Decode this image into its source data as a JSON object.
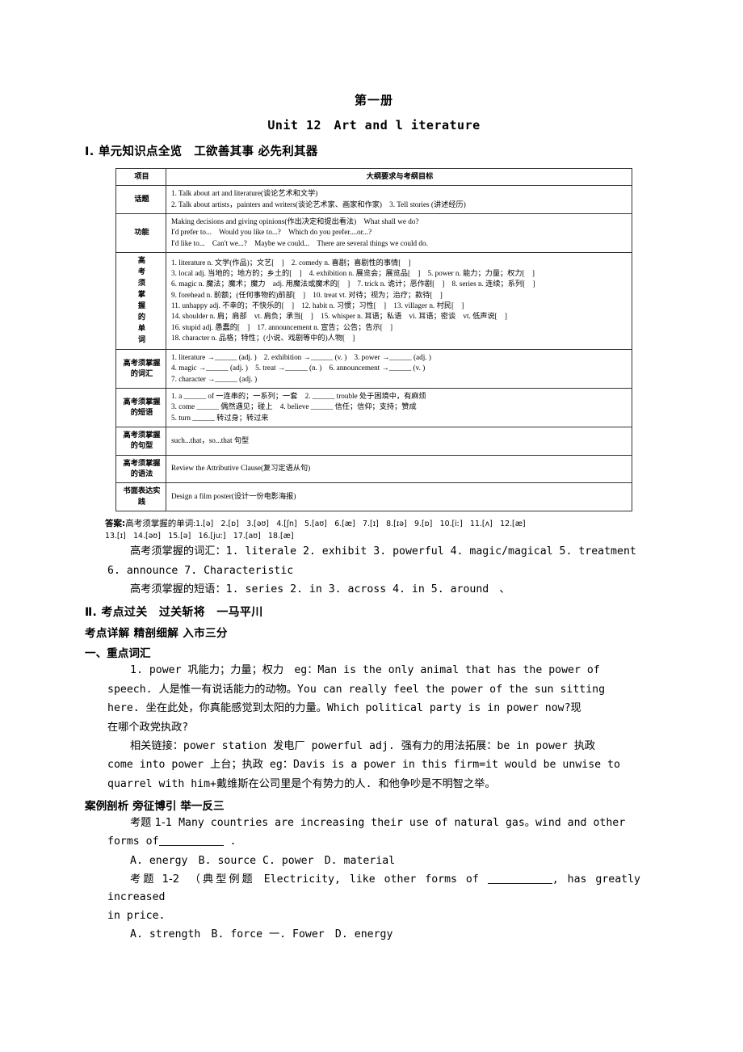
{
  "header": {
    "book": "第一册",
    "unit": "Unit 12　Art and l iterature",
    "section1": "Ⅰ. 单元知识点全览　工欲善其事 必先利其器"
  },
  "table": {
    "col1_header": "项目",
    "col2_header": "大纲要求与考纲目标",
    "rows": [
      {
        "label": "话题",
        "lines": [
          "1. Talk about art and literature(谈论艺术和文学)",
          "2. Talk about artists，painters and writers(谈论艺术家、画家和作家)　3. Tell stories (讲述经历)"
        ]
      },
      {
        "label": "功能",
        "lines": [
          "Making decisions and giving opinions(作出决定和提出看法)　What shall we do?",
          "I'd prefer to...　Would you like to...?　Which do you prefer....or...?",
          "I'd like to...　Can't we...?　Maybe we could...　There are several things we could do."
        ]
      },
      {
        "label_vertical": [
          "高",
          "考",
          "须",
          "掌",
          "握",
          "的",
          "单",
          "词"
        ],
        "lines": [
          "1. literature n. 文学(作品)；文艺[　]　2. comedy n. 喜剧；喜剧性的事情[　]",
          "3. local adj. 当地的；地方的；乡土的[　]　4. exhibition n. 展览会；展览品[　]　5. power n. 能力；力量；权力[　]",
          "6. magic n. 魔法；魔术；魔力　adj. 用魔法或魔术的[　]　7. trick n. 诡计；恶作剧[　]　8. series n. 连续；系列[　]",
          "9. forehead n. 前额；(任何事物的)前部[　]　10. treat vt. 对待；视为；治疗；款待[　]",
          "11. unhappy adj. 不幸的；不快乐的[　]　12. habit n. 习惯；习性[　]　13. villager n. 村民[　]",
          "14. shoulder n. 肩；肩部　vt. 肩负；承当[　]　15. whisper n. 耳语；私语　vi. 耳语；密谈　vt. 低声说[　]",
          "16. stupid adj. 愚蠢的[　]　17. announcement n. 宣告；公告；告示[　]",
          "18. character n. 品格；特性；(小说、戏剧等中的)人物[　]"
        ]
      },
      {
        "label": "高考须掌握的词汇",
        "lines": [
          "1. literature →______ (adj. )　2. exhibition →______ (v. )　3. power →______ (adj. )",
          "4. magic →______ (adj. )　5. treat →______ (n. )　6. announcement →______ (v. )",
          "7. character →______ (adj. )"
        ]
      },
      {
        "label": "高考须掌握的短语",
        "lines": [
          "1. a ______ of 一连串的；一系列；一套　2. ______ trouble 处于困境中，有麻烦",
          "3. come ______ 偶然遇见；碰上　4. believe ______ 信任；信仰；支持；赞成",
          "5. turn ______ 转过身；转过来"
        ]
      },
      {
        "label": "高考须掌握的句型",
        "lines": [
          "such...that，so...that 句型"
        ]
      },
      {
        "label": "高考须掌握的语法",
        "lines": [
          "Review the Attributive Clause(复习定语从句)"
        ]
      },
      {
        "label": "书面表达实践",
        "lines": [
          "Design a film poster(设计一份电影海报)"
        ]
      }
    ]
  },
  "answers": {
    "lead": "答案:",
    "words_label": "高考须掌握的单词:",
    "ipa_line1": "1.[ə]　2.[ɒ]　3.[əʊ]　4.[ʃn]　5.[aʊ]　6.[æ]　7.[ɪ]　8.[ɪə]　9.[ɒ]　10.[iː]　11.[ʌ]　12.[æ]",
    "ipa_line2": "13.[ɪ]　14.[əʊ]　15.[ə]　16.[juː]　17.[aʊ]　18.[æ]",
    "vocab_line1": "高考须掌握的词汇：1. literale 2. exhibit 3. powerful 4. magic/magical 5. treatment",
    "vocab_line2": "6. announce 7. Characteristic",
    "phrases_line": "高考须掌握的短语：1. series  2. in  3. across  4. in  5. around　、"
  },
  "section2": {
    "heading": "Ⅱ. 考点过关　过关斩将　一马平川",
    "sub_heading": "考点详解 精剖细解 入市三分",
    "topic_heading": "一、重点词汇",
    "power_entry_l1": "1. power 巩能力；力量；权力　eg：Man is the only animal that has the power of",
    "power_entry_l2": "speech. 人是惟一有说话能力的动物。You can really feel the power of the sun sitting",
    "power_entry_l3": "here. 坐在此处，你真能感觉到太阳的力量。Which political party is in power now?现",
    "power_entry_l4": "在哪个政党执政?",
    "link_l1": "相关链接：power station 发电厂 powerful adj. 强有力的用法拓展：be in power 执政",
    "link_l2": "come into power 上台；执政 eg：Davis is a power in this firm=it would be unwise to",
    "link_l3": "quarrel with him+戴维斯在公司里是个有势力的人. 和他争吵是不明智之举。"
  },
  "cases": {
    "heading": "案例剖析 旁征博引 举一反三",
    "q1_label": "考题 1-1",
    "q1_l1": "Many countries are increasing their use of natural gas。wind and other",
    "q1_l2_pre": "forms of",
    "q1_l2_post": ".",
    "q1_options": "A. energy　B. source C. power　D. material",
    "q2_label": "考题 1-2",
    "q2_l1_pre": "（典型例题 Electricity, like other forms of",
    "q2_l1_post": ", has greatly increased",
    "q2_l2": "in price.",
    "q2_options": "A. strength　B. force 一. Fower　D. energy"
  }
}
